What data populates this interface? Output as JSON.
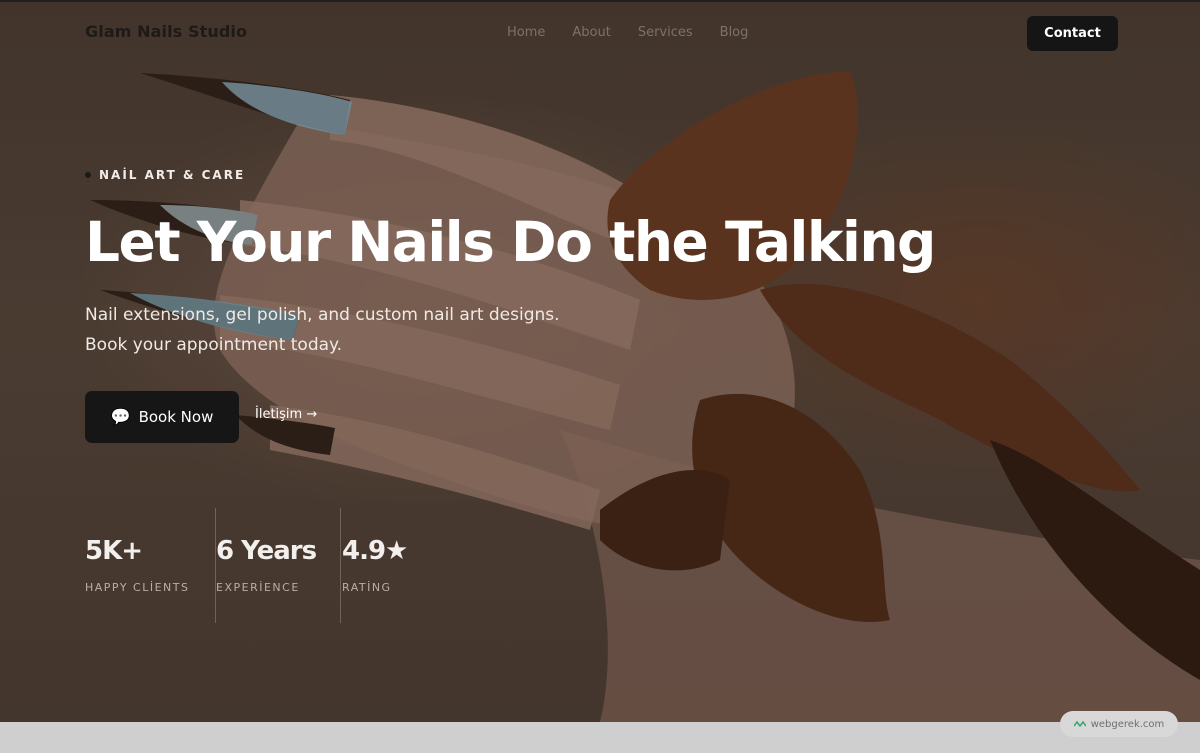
{
  "header": {
    "brand": "Glam Nails Studio",
    "nav": [
      "Home",
      "About",
      "Services",
      "Blog"
    ],
    "contact_label": "Contact"
  },
  "hero": {
    "eyebrow": "NAİL ART & CARE",
    "title": "Let Your Nails Do the Talking",
    "subtitle": "Nail extensions, gel polish, and custom nail art designs. Book your appointment today.",
    "primary_cta": "Book Now",
    "primary_cta_icon": "speech-bubble-icon",
    "secondary_cta": "İletişim →"
  },
  "stats": [
    {
      "value": "5K+",
      "label": "HAPPY CLİENTS"
    },
    {
      "value": "6 Years",
      "label": "EXPERİENCE"
    },
    {
      "value": "4.9★",
      "label": "RATİNG"
    }
  ],
  "watermark": {
    "text": "webgerek.com"
  },
  "colors": {
    "accent_dark": "#151515",
    "hero_brown": "#4a3b31",
    "ribbon_brown": "#6b3a1f",
    "text_light": "#ffffff"
  }
}
